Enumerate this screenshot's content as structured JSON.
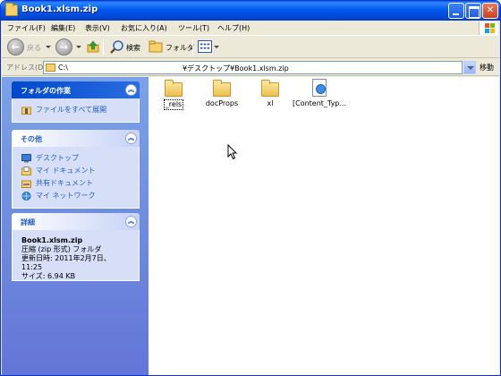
{
  "window": {
    "title": "Book1.xlsm.zip"
  },
  "menu": [
    "ファイル(F)",
    "編集(E)",
    "表示(V)",
    "お気に入り(A)",
    "ツール(T)",
    "ヘルプ(H)"
  ],
  "toolbar": {
    "back_label": "戻る",
    "search_label": "検索",
    "folders_label": "フォルダ"
  },
  "address": {
    "label": "アドレス(D)",
    "drive": "C:\\",
    "path": "¥デスクトップ¥Book1.xlsm.zip",
    "go_label": "移動"
  },
  "sidebar": {
    "folder_tasks": {
      "title": "フォルダの作業",
      "items": [
        {
          "label": "ファイルをすべて展開",
          "icon": "extract-icon"
        }
      ]
    },
    "other_places": {
      "title": "その他",
      "items": [
        {
          "label": "デスクトップ",
          "icon": "desktop-icon"
        },
        {
          "label": "マイ ドキュメント",
          "icon": "my-documents-icon"
        },
        {
          "label": "共有ドキュメント",
          "icon": "shared-documents-icon"
        },
        {
          "label": "マイ ネットワーク",
          "icon": "network-icon"
        }
      ]
    },
    "details": {
      "title": "詳細",
      "name": "Book1.xlsm.zip",
      "type": "圧縮 (zip 形式) フォルダ",
      "modified": "更新日時: 2011年2月7日、11:25",
      "size": "サイズ: 6.94 KB"
    }
  },
  "files": [
    {
      "name": "_rels",
      "kind": "folder"
    },
    {
      "name": "docProps",
      "kind": "folder"
    },
    {
      "name": "xl",
      "kind": "folder"
    },
    {
      "name": "[Content_Typ...",
      "kind": "xml-document"
    }
  ],
  "colors": {
    "titlebar": "#0058EE",
    "sidebar_bg": "#6F8FE0",
    "link": "#215DC6"
  }
}
